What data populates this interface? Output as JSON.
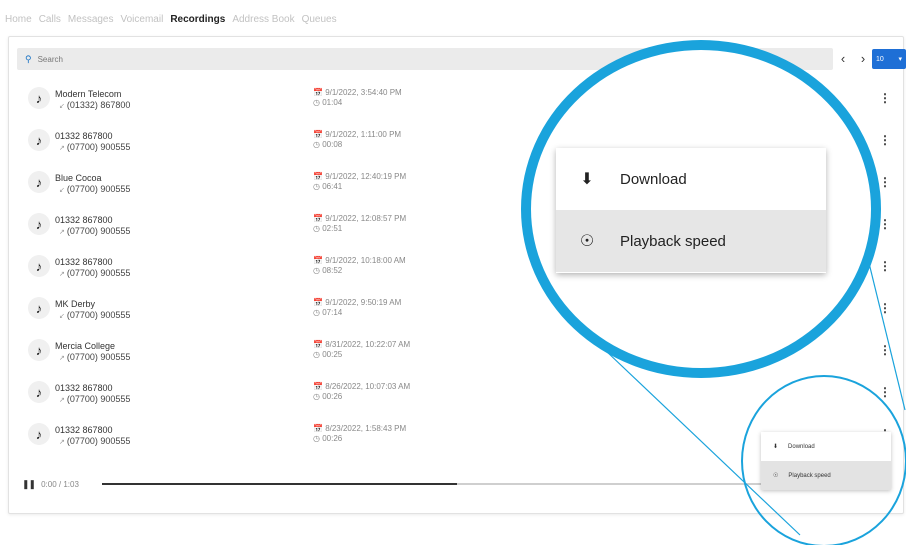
{
  "nav": {
    "tabs": [
      {
        "label": "Home"
      },
      {
        "label": "Calls"
      },
      {
        "label": "Messages"
      },
      {
        "label": "Voicemail"
      },
      {
        "label": "Recordings"
      },
      {
        "label": "Address Book"
      },
      {
        "label": "Queues"
      }
    ],
    "active": "Recordings"
  },
  "search": {
    "placeholder": "Search"
  },
  "pager": {
    "prev": "‹",
    "next": "›",
    "view_label": "10"
  },
  "recordings": [
    {
      "name": "Modern Telecom",
      "number": "(01332) 867800",
      "datetime": "9/1/2022, 3:54:40 PM",
      "duration": "01:04"
    },
    {
      "name": "01332 867800",
      "number": "(07700) 900555",
      "datetime": "9/1/2022, 1:11:00 PM",
      "duration": "00:08"
    },
    {
      "name": "Blue Cocoa",
      "number": "(07700) 900555",
      "datetime": "9/1/2022, 12:40:19 PM",
      "duration": "06:41"
    },
    {
      "name": "01332 867800",
      "number": "(07700) 900555",
      "datetime": "9/1/2022, 12:08:57 PM",
      "duration": "02:51"
    },
    {
      "name": "01332 867800",
      "number": "(07700) 900555",
      "datetime": "9/1/2022, 10:18:00 AM",
      "duration": "08:52"
    },
    {
      "name": "MK Derby",
      "number": "(07700) 900555",
      "datetime": "9/1/2022, 9:50:19 AM",
      "duration": "07:14"
    },
    {
      "name": "Mercia College",
      "number": "(07700) 900555",
      "datetime": "8/31/2022, 10:22:07 AM",
      "duration": "00:25"
    },
    {
      "name": "01332 867800",
      "number": "(07700) 900555",
      "datetime": "8/26/2022, 10:07:03 AM",
      "duration": "00:26"
    },
    {
      "name": "01332 867800",
      "number": "(07700) 900555",
      "datetime": "8/23/2022, 1:58:43 PM",
      "duration": "00:26"
    }
  ],
  "player": {
    "time": "0:00 / 1:03",
    "progress": 0.53
  },
  "menu": {
    "download_label": "Download",
    "playback_label": "Playback speed"
  },
  "colors": {
    "zoom_ring": "#1aa3dc",
    "accent": "#1e6fd6"
  },
  "icons": {
    "recording": "music-note-icon",
    "download": "download-icon",
    "playback": "playback-speed-icon",
    "more": "more-vertical-icon",
    "search": "search-icon",
    "pause": "pause-icon"
  }
}
